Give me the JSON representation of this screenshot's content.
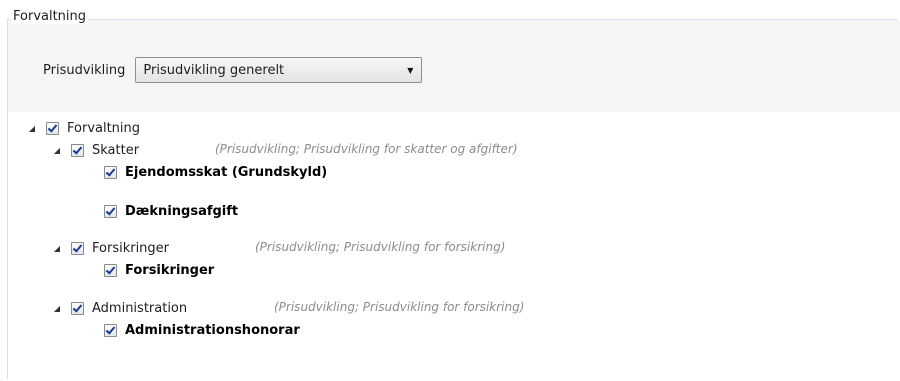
{
  "group": {
    "title": "Forvaltning"
  },
  "filter": {
    "label": "Prisudvikling",
    "selected": "Prisudvikling generelt"
  },
  "tree": {
    "root": {
      "label": "Forvaltning"
    },
    "skatter": {
      "label": "Skatter",
      "desc": "(Prisudvikling; Prisudvikling for skatter og afgifter)",
      "children": [
        "Ejendomsskat (Grundskyld)",
        "Dækningsafgift"
      ]
    },
    "forsikringer": {
      "label": "Forsikringer",
      "desc": "(Prisudvikling; Prisudvikling for forsikring)",
      "children": [
        "Forsikringer"
      ]
    },
    "administration": {
      "label": "Administration",
      "desc": "(Prisudvikling; Prisudvikling for forsikring)",
      "children": [
        "Administrationshonorar"
      ]
    }
  }
}
